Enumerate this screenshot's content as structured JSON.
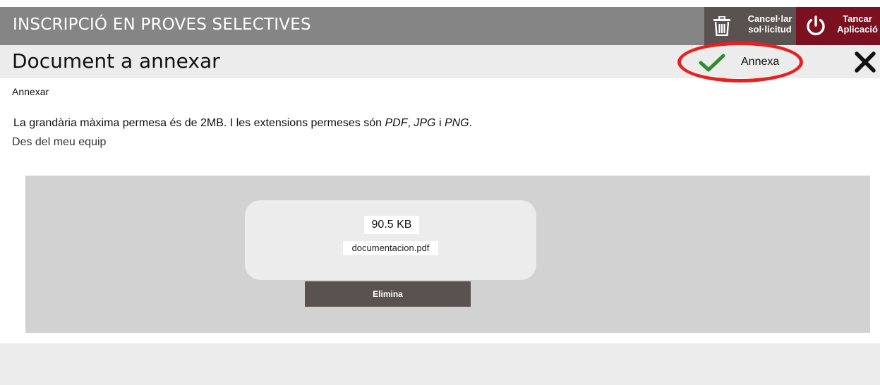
{
  "header": {
    "app_title": "INSCRIPCIÓ EN PROVES SELECTIVES",
    "cancel_button": {
      "line1": "Cancel·lar",
      "line2": "sol·licitud",
      "icon": "trash-icon"
    },
    "close_app_button": {
      "line1": "Tancar",
      "line2": "Aplicació",
      "icon": "power-icon"
    }
  },
  "subheader": {
    "title": "Document a annexar",
    "annex_button": {
      "label": "Annexa",
      "icon": "checkmark-icon"
    },
    "close_icon": "close-icon"
  },
  "content": {
    "section_label": "Annexar",
    "info": {
      "prefix": "La grandària màxima permesa és de 2MB. I les extensions permeses són ",
      "ext1": "PDF",
      "sep1": ", ",
      "ext2": "JPG",
      "sep2": " i ",
      "ext3": "PNG",
      "suffix": "."
    },
    "source_link": "Des del meu equip"
  },
  "file": {
    "size": "90.5 KB",
    "name": "documentacion.pdf",
    "delete_label": "Elimina"
  },
  "colors": {
    "topbar": "#858585",
    "cancel_bg": "#5a5250",
    "close_app_bg": "#7a1020",
    "check_green": "#2e8b2e",
    "highlight_ring": "#e82020",
    "dropzone": "#d2d2d2"
  }
}
